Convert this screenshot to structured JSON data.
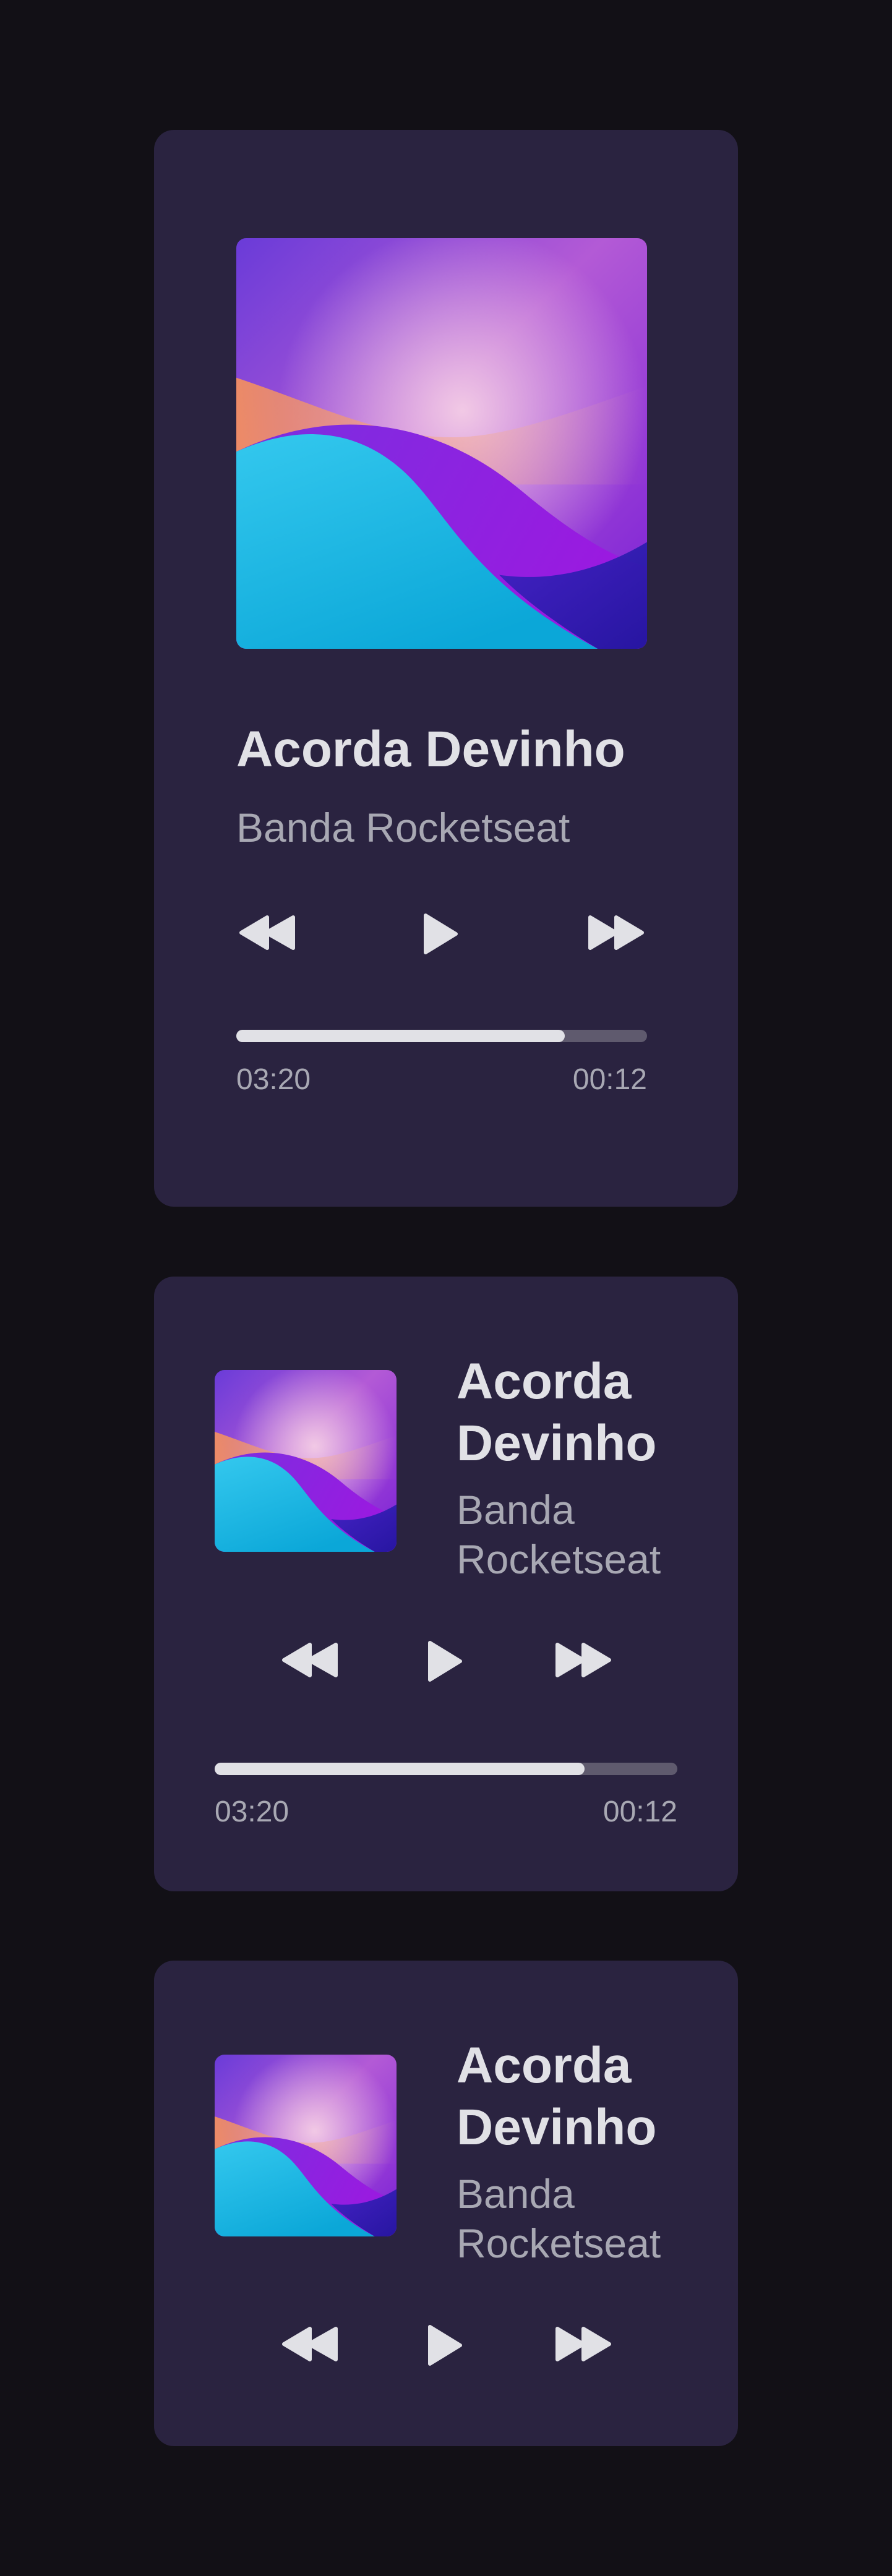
{
  "colors": {
    "background": "#121016",
    "card": "#2a2340",
    "title": "#e1e1e6",
    "subtitle": "#a8a8b3",
    "progress_track": "#5f5a6e",
    "progress_fill": "#e1e1e6"
  },
  "icons": {
    "previous": "rewind-icon",
    "play": "play-icon",
    "next": "fast-forward-icon"
  },
  "cards": [
    {
      "variant": "vertical",
      "title": "Acorda Devinho",
      "artist": "Banda Rocketseat",
      "current_time": "03:20",
      "remaining_time": "00:12",
      "progress": 0.8
    },
    {
      "variant": "horizontal",
      "title_lines": [
        "Acorda",
        "Devinho"
      ],
      "artist_lines": [
        "Banda",
        "Rocketseat"
      ],
      "current_time": "03:20",
      "remaining_time": "00:12",
      "progress": 0.8
    },
    {
      "variant": "compact",
      "title_lines": [
        "Acorda",
        "Devinho"
      ],
      "artist_lines": [
        "Banda",
        "Rocketseat"
      ]
    }
  ]
}
